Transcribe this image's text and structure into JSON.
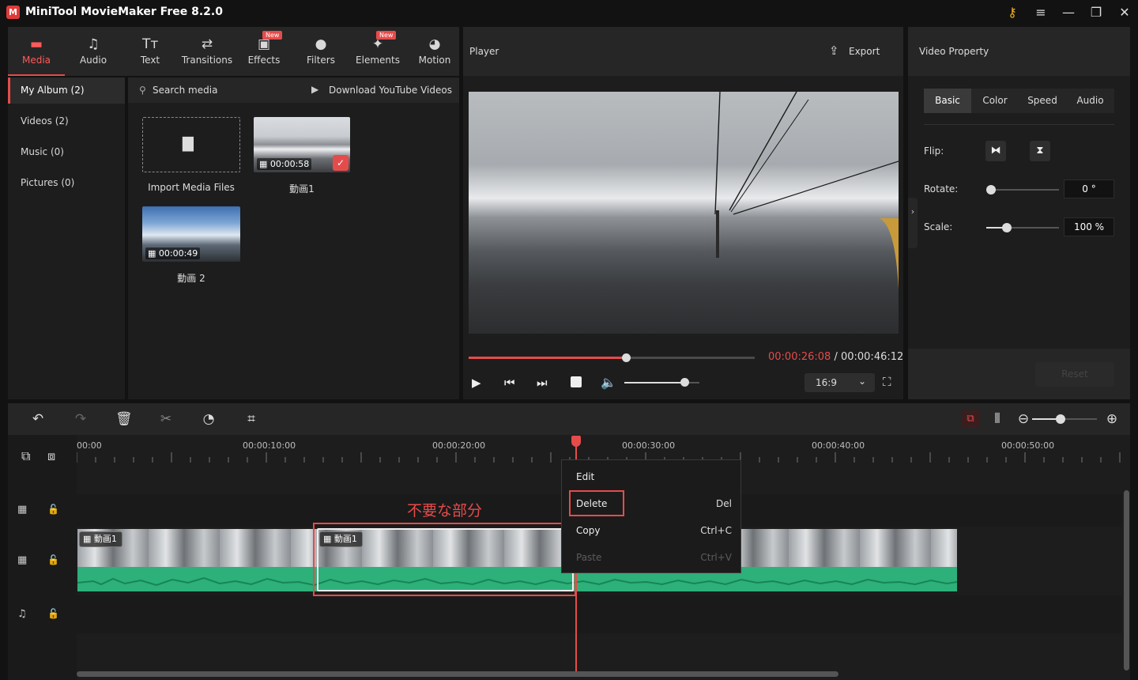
{
  "app": {
    "logo": "M",
    "title": "MiniTool MovieMaker Free 8.2.0",
    "window_controls": [
      "key-icon",
      "menu-icon",
      "minimize-icon",
      "maximize-icon",
      "close-icon"
    ]
  },
  "top_tools": [
    {
      "label": "Media",
      "icon": "media-folder-icon",
      "active": true,
      "new": false
    },
    {
      "label": "Audio",
      "icon": "music-note-icon",
      "active": false,
      "new": false
    },
    {
      "label": "Text",
      "icon": "text-icon",
      "active": false,
      "new": false
    },
    {
      "label": "Transitions",
      "icon": "transitions-icon",
      "active": false,
      "new": false
    },
    {
      "label": "Effects",
      "icon": "effects-icon",
      "active": false,
      "new": true
    },
    {
      "label": "Filters",
      "icon": "filters-icon",
      "active": false,
      "new": false
    },
    {
      "label": "Elements",
      "icon": "elements-icon",
      "active": false,
      "new": true
    },
    {
      "label": "Motion",
      "icon": "motion-icon",
      "active": false,
      "new": false
    }
  ],
  "new_badge": "New",
  "sidebar": {
    "items": [
      {
        "label": "My Album (2)",
        "active": true
      },
      {
        "label": "Videos (2)",
        "active": false
      },
      {
        "label": "Music (0)",
        "active": false
      },
      {
        "label": "Pictures (0)",
        "active": false
      }
    ]
  },
  "media": {
    "search_label": "Search media",
    "download_label": "Download YouTube Videos",
    "import_label": "Import Media Files",
    "clips": [
      {
        "name": "動画1",
        "duration": "00:00:58",
        "selected": true
      },
      {
        "name": "動画 2",
        "duration": "00:00:49",
        "selected": false
      }
    ]
  },
  "player": {
    "title": "Player",
    "export_label": "Export",
    "current_time": "00:00:26:08",
    "separator": " / ",
    "total_time": "00:00:46:12",
    "progress": 0.55,
    "volume": 0.8,
    "aspect_ratio": "16:9"
  },
  "video_property": {
    "title": "Video Property",
    "tabs": [
      "Basic",
      "Color",
      "Speed",
      "Audio"
    ],
    "active_tab": "Basic",
    "flip_label": "Flip:",
    "rotate_label": "Rotate:",
    "rotate_value": "0 °",
    "rotate_level": 0.0,
    "scale_label": "Scale:",
    "scale_value": "100 %",
    "scale_level": 0.28,
    "reset_label": "Reset"
  },
  "timeline": {
    "ruler_labels": [
      "00:00",
      "00:00:10:00",
      "00:00:20:00",
      "00:00:30:00",
      "00:00:40:00",
      "00:00:50:00"
    ],
    "clip_label": "動画1",
    "annotation": "不要な部分"
  },
  "context_menu": {
    "items": [
      {
        "label": "Edit",
        "shortcut": "",
        "disabled": false
      },
      {
        "label": "Delete",
        "shortcut": "Del",
        "disabled": false
      },
      {
        "label": "Copy",
        "shortcut": "Ctrl+C",
        "disabled": false
      },
      {
        "label": "Paste",
        "shortcut": "Ctrl+V",
        "disabled": true
      }
    ]
  },
  "colors": {
    "accent": "#e64b4b",
    "waveform": "#2db07a",
    "background": "#121212",
    "panel": "#1d1d1d"
  }
}
